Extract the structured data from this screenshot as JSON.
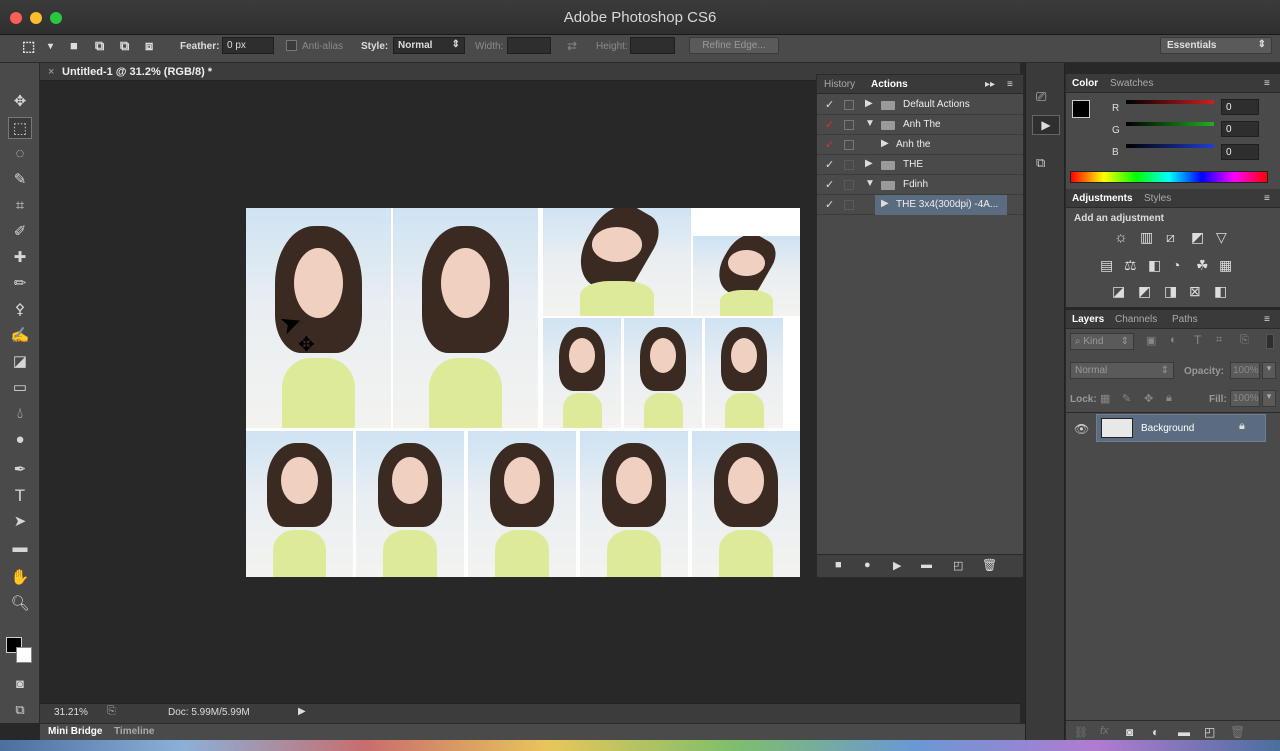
{
  "app": {
    "title": "Adobe Photoshop CS6"
  },
  "options": {
    "feather_label": "Feather:",
    "feather_value": "0 px",
    "antialias_label": "Anti-alias",
    "style_label": "Style:",
    "style_value": "Normal",
    "width_label": "Width:",
    "height_label": "Height:",
    "refine_edge": "Refine Edge...",
    "workspace": "Essentials"
  },
  "document": {
    "tab_title": "Untitled-1 @ 31.2% (RGB/8) *",
    "zoom": "31.21%",
    "doc_size": "Doc: 5.99M/5.99M"
  },
  "bottom_tabs": [
    "Mini Bridge",
    "Timeline"
  ],
  "actions_panel": {
    "tabs": [
      "History",
      "Actions"
    ],
    "rows": [
      {
        "label": "Default Actions",
        "expanded": false
      },
      {
        "label": "Anh The",
        "expanded": true
      },
      {
        "label": "Anh the",
        "expanded": false
      },
      {
        "label": "THE",
        "expanded": false
      },
      {
        "label": "Fdinh",
        "expanded": true
      },
      {
        "label": "THE 3x4(300dpi) -4A...",
        "expanded": false
      }
    ]
  },
  "color_panel": {
    "tabs": [
      "Color",
      "Swatches"
    ],
    "r_label": "R",
    "g_label": "G",
    "b_label": "B",
    "r": "0",
    "g": "0",
    "b": "0",
    "r_color": "#d01f1f",
    "g_color": "#1fae1f",
    "b_color": "#1f3fd0"
  },
  "adjustments_panel": {
    "tabs": [
      "Adjustments",
      "Styles"
    ],
    "heading": "Add an adjustment"
  },
  "layers_panel": {
    "tabs": [
      "Layers",
      "Channels",
      "Paths"
    ],
    "filter": "Kind",
    "blend_mode": "Normal",
    "opacity_label": "Opacity:",
    "opacity": "100%",
    "lock_label": "Lock:",
    "fill_label": "Fill:",
    "fill": "100%",
    "layer_name": "Background"
  }
}
